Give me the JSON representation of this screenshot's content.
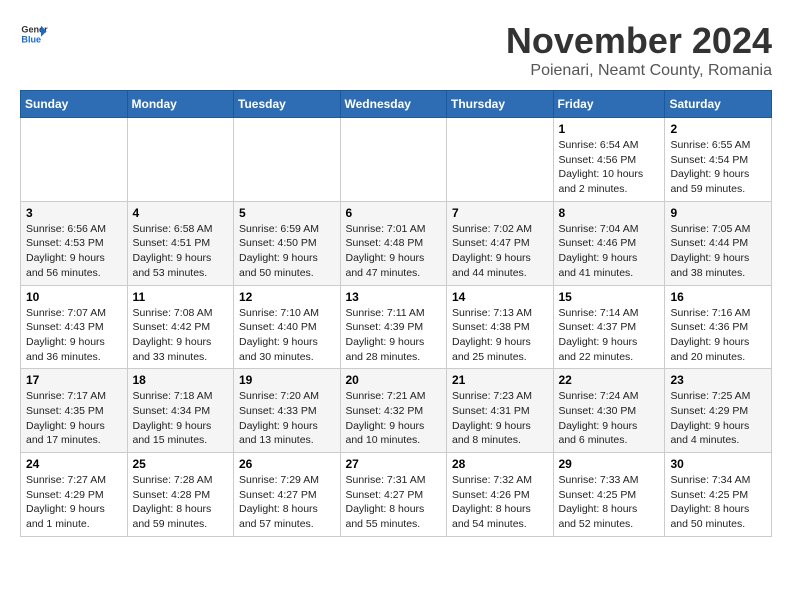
{
  "logo": {
    "line1": "General",
    "line2": "Blue"
  },
  "title": "November 2024",
  "location": "Poienari, Neamt County, Romania",
  "days_of_week": [
    "Sunday",
    "Monday",
    "Tuesday",
    "Wednesday",
    "Thursday",
    "Friday",
    "Saturday"
  ],
  "weeks": [
    [
      {
        "day": "",
        "info": ""
      },
      {
        "day": "",
        "info": ""
      },
      {
        "day": "",
        "info": ""
      },
      {
        "day": "",
        "info": ""
      },
      {
        "day": "",
        "info": ""
      },
      {
        "day": "1",
        "info": "Sunrise: 6:54 AM\nSunset: 4:56 PM\nDaylight: 10 hours\nand 2 minutes."
      },
      {
        "day": "2",
        "info": "Sunrise: 6:55 AM\nSunset: 4:54 PM\nDaylight: 9 hours\nand 59 minutes."
      }
    ],
    [
      {
        "day": "3",
        "info": "Sunrise: 6:56 AM\nSunset: 4:53 PM\nDaylight: 9 hours\nand 56 minutes."
      },
      {
        "day": "4",
        "info": "Sunrise: 6:58 AM\nSunset: 4:51 PM\nDaylight: 9 hours\nand 53 minutes."
      },
      {
        "day": "5",
        "info": "Sunrise: 6:59 AM\nSunset: 4:50 PM\nDaylight: 9 hours\nand 50 minutes."
      },
      {
        "day": "6",
        "info": "Sunrise: 7:01 AM\nSunset: 4:48 PM\nDaylight: 9 hours\nand 47 minutes."
      },
      {
        "day": "7",
        "info": "Sunrise: 7:02 AM\nSunset: 4:47 PM\nDaylight: 9 hours\nand 44 minutes."
      },
      {
        "day": "8",
        "info": "Sunrise: 7:04 AM\nSunset: 4:46 PM\nDaylight: 9 hours\nand 41 minutes."
      },
      {
        "day": "9",
        "info": "Sunrise: 7:05 AM\nSunset: 4:44 PM\nDaylight: 9 hours\nand 38 minutes."
      }
    ],
    [
      {
        "day": "10",
        "info": "Sunrise: 7:07 AM\nSunset: 4:43 PM\nDaylight: 9 hours\nand 36 minutes."
      },
      {
        "day": "11",
        "info": "Sunrise: 7:08 AM\nSunset: 4:42 PM\nDaylight: 9 hours\nand 33 minutes."
      },
      {
        "day": "12",
        "info": "Sunrise: 7:10 AM\nSunset: 4:40 PM\nDaylight: 9 hours\nand 30 minutes."
      },
      {
        "day": "13",
        "info": "Sunrise: 7:11 AM\nSunset: 4:39 PM\nDaylight: 9 hours\nand 28 minutes."
      },
      {
        "day": "14",
        "info": "Sunrise: 7:13 AM\nSunset: 4:38 PM\nDaylight: 9 hours\nand 25 minutes."
      },
      {
        "day": "15",
        "info": "Sunrise: 7:14 AM\nSunset: 4:37 PM\nDaylight: 9 hours\nand 22 minutes."
      },
      {
        "day": "16",
        "info": "Sunrise: 7:16 AM\nSunset: 4:36 PM\nDaylight: 9 hours\nand 20 minutes."
      }
    ],
    [
      {
        "day": "17",
        "info": "Sunrise: 7:17 AM\nSunset: 4:35 PM\nDaylight: 9 hours\nand 17 minutes."
      },
      {
        "day": "18",
        "info": "Sunrise: 7:18 AM\nSunset: 4:34 PM\nDaylight: 9 hours\nand 15 minutes."
      },
      {
        "day": "19",
        "info": "Sunrise: 7:20 AM\nSunset: 4:33 PM\nDaylight: 9 hours\nand 13 minutes."
      },
      {
        "day": "20",
        "info": "Sunrise: 7:21 AM\nSunset: 4:32 PM\nDaylight: 9 hours\nand 10 minutes."
      },
      {
        "day": "21",
        "info": "Sunrise: 7:23 AM\nSunset: 4:31 PM\nDaylight: 9 hours\nand 8 minutes."
      },
      {
        "day": "22",
        "info": "Sunrise: 7:24 AM\nSunset: 4:30 PM\nDaylight: 9 hours\nand 6 minutes."
      },
      {
        "day": "23",
        "info": "Sunrise: 7:25 AM\nSunset: 4:29 PM\nDaylight: 9 hours\nand 4 minutes."
      }
    ],
    [
      {
        "day": "24",
        "info": "Sunrise: 7:27 AM\nSunset: 4:29 PM\nDaylight: 9 hours\nand 1 minute."
      },
      {
        "day": "25",
        "info": "Sunrise: 7:28 AM\nSunset: 4:28 PM\nDaylight: 8 hours\nand 59 minutes."
      },
      {
        "day": "26",
        "info": "Sunrise: 7:29 AM\nSunset: 4:27 PM\nDaylight: 8 hours\nand 57 minutes."
      },
      {
        "day": "27",
        "info": "Sunrise: 7:31 AM\nSunset: 4:27 PM\nDaylight: 8 hours\nand 55 minutes."
      },
      {
        "day": "28",
        "info": "Sunrise: 7:32 AM\nSunset: 4:26 PM\nDaylight: 8 hours\nand 54 minutes."
      },
      {
        "day": "29",
        "info": "Sunrise: 7:33 AM\nSunset: 4:25 PM\nDaylight: 8 hours\nand 52 minutes."
      },
      {
        "day": "30",
        "info": "Sunrise: 7:34 AM\nSunset: 4:25 PM\nDaylight: 8 hours\nand 50 minutes."
      }
    ]
  ]
}
